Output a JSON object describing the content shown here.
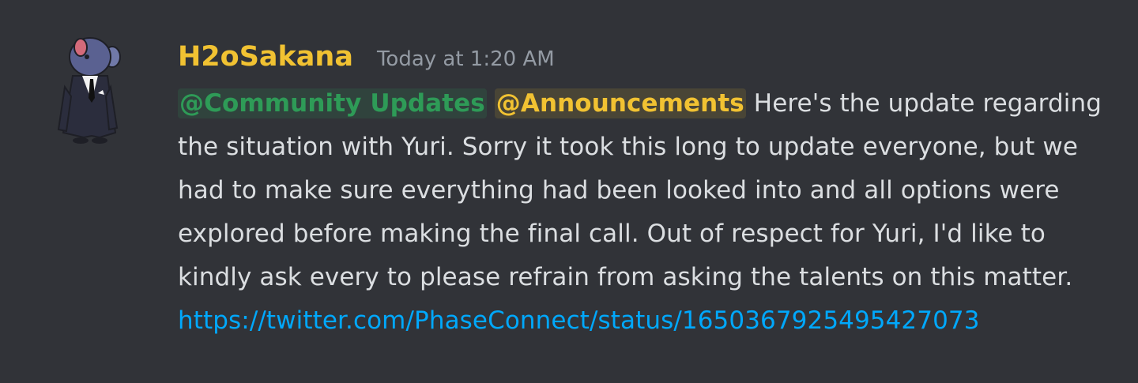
{
  "message": {
    "username": "H2oSakana",
    "username_color": "#f1c232",
    "timestamp": "Today at 1:20 AM",
    "mentions": [
      {
        "label": "@Community Updates",
        "color": "#2e9b57"
      },
      {
        "label": "@Announcements",
        "color": "#f1c232"
      }
    ],
    "text": "Here's the update regarding the situation with Yuri. Sorry it took this long to update everyone, but we had to make sure everything had been looked into and all options were explored before making the final call. Out of respect for Yuri, I'd like to kindly ask every to please refrain from asking the talents on this matter.",
    "link": "https://twitter.com/PhaseConnect/status/1650367925495427073",
    "avatar_icon": "fish-in-suit-avatar"
  },
  "theme": {
    "background": "#313338",
    "text": "#dbdee1",
    "muted": "#949ba4",
    "link": "#00a8fc"
  }
}
